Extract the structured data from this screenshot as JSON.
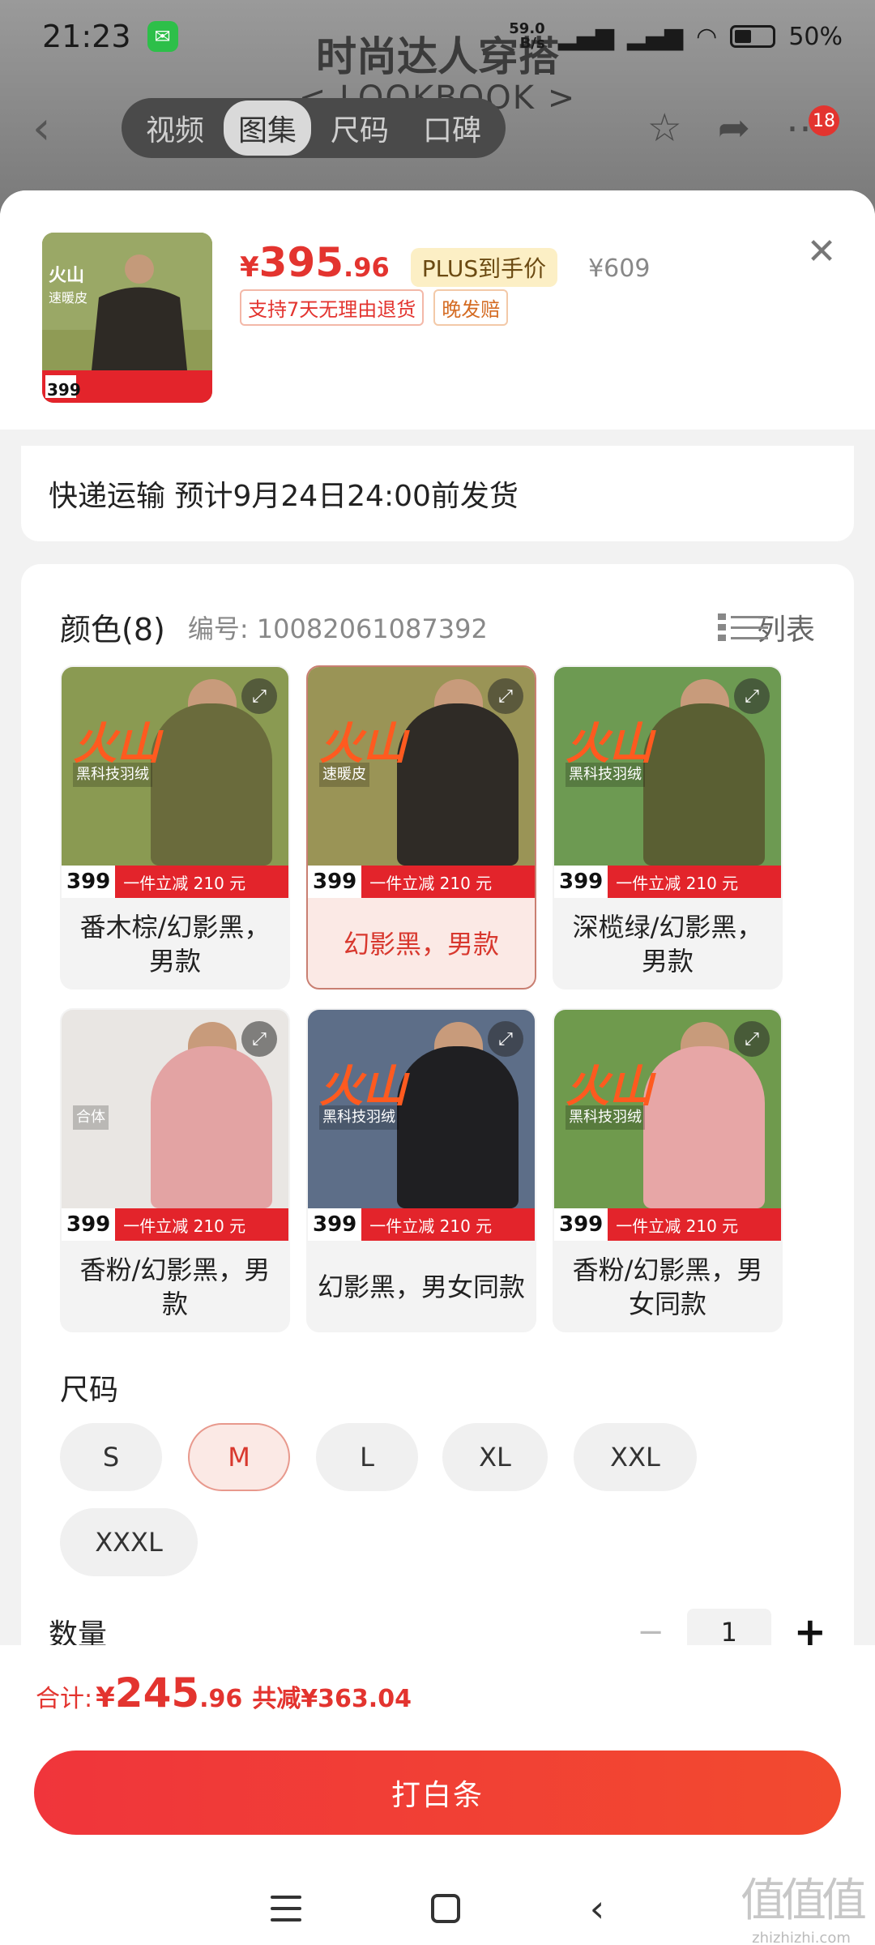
{
  "status": {
    "time": "21:23",
    "net_speed_top": "59.0",
    "net_speed_bottom": "B/s",
    "battery": "50%"
  },
  "background": {
    "title": "时尚达人穿搭",
    "subtitle": "< LOOKBOOK >",
    "tabs": [
      "视频",
      "图集",
      "尺码",
      "口碑"
    ],
    "active_tab": "图集",
    "badge_count": "18"
  },
  "product": {
    "thumb_price": "399",
    "thumb_promo": "一件立减 210 元",
    "price_symbol": "¥",
    "price_int": "395",
    "price_dec": ".96",
    "plus_label": "PLUS到手价",
    "original_price": "¥609",
    "tags": [
      "支持7天无理由退货",
      "晚发赔"
    ]
  },
  "shipping": {
    "text": "快递运输 预计9月24日24:00前发货"
  },
  "colors": {
    "title": "颜色(8)",
    "code": "编号: 10082061087392",
    "list_label": "列表",
    "items": [
      {
        "label": "番木棕/幻影黑，男款",
        "selected": false,
        "badge": "399",
        "promo": "一件立减  210 元",
        "brand": "火山",
        "sub": "黑科技羽绒",
        "bg": "#8a9a52",
        "coat": "#6a6b3c",
        "selected_label": false
      },
      {
        "label": "幻影黑，男款",
        "selected": true,
        "badge": "399",
        "promo": "一件立减  210 元",
        "brand": "火山",
        "sub": "速暖皮",
        "bg": "#9a9456",
        "coat": "#2f2b26"
      },
      {
        "label": "深榄绿/幻影黑，男款",
        "selected": false,
        "badge": "399",
        "promo": "一件立减  210 元",
        "brand": "火山",
        "sub": "黑科技羽绒",
        "bg": "#6d9a52",
        "coat": "#5a5f33"
      },
      {
        "label": "香粉/幻影黑，男款",
        "selected": false,
        "badge": "399",
        "promo": "一件立减  210 元",
        "brand": "",
        "sub": "合体",
        "bg": "#e9e6e3",
        "coat": "#e3a3a3"
      },
      {
        "label": "幻影黑，男女同款",
        "selected": false,
        "badge": "399",
        "promo": "一件立减  210 元",
        "brand": "火山",
        "sub": "黑科技羽绒",
        "bg": "#5d6e88",
        "coat": "#1f1f22"
      },
      {
        "label": "香粉/幻影黑，男女同款",
        "selected": false,
        "badge": "399",
        "promo": "一件立减  210 元",
        "brand": "火山",
        "sub": "黑科技羽绒",
        "bg": "#6f9a4d",
        "coat": "#e7a6a6"
      }
    ]
  },
  "sizes": {
    "title": "尺码",
    "options": [
      "S",
      "M",
      "L",
      "XL",
      "XXL",
      "XXXL"
    ],
    "selected": "M"
  },
  "quantity": {
    "title": "数量",
    "value": "1",
    "minus": "−",
    "plus": "+"
  },
  "footer": {
    "total_label": "合计:",
    "total_symbol": "¥",
    "total_int": "245",
    "total_dec": ".96",
    "saving": "共减¥363.04",
    "buy_label": "打白条"
  },
  "watermark": {
    "glyphs": "值值值",
    "site": "zhizhizhi.com"
  },
  "colors_theme": {
    "accent": "#e3342f"
  }
}
